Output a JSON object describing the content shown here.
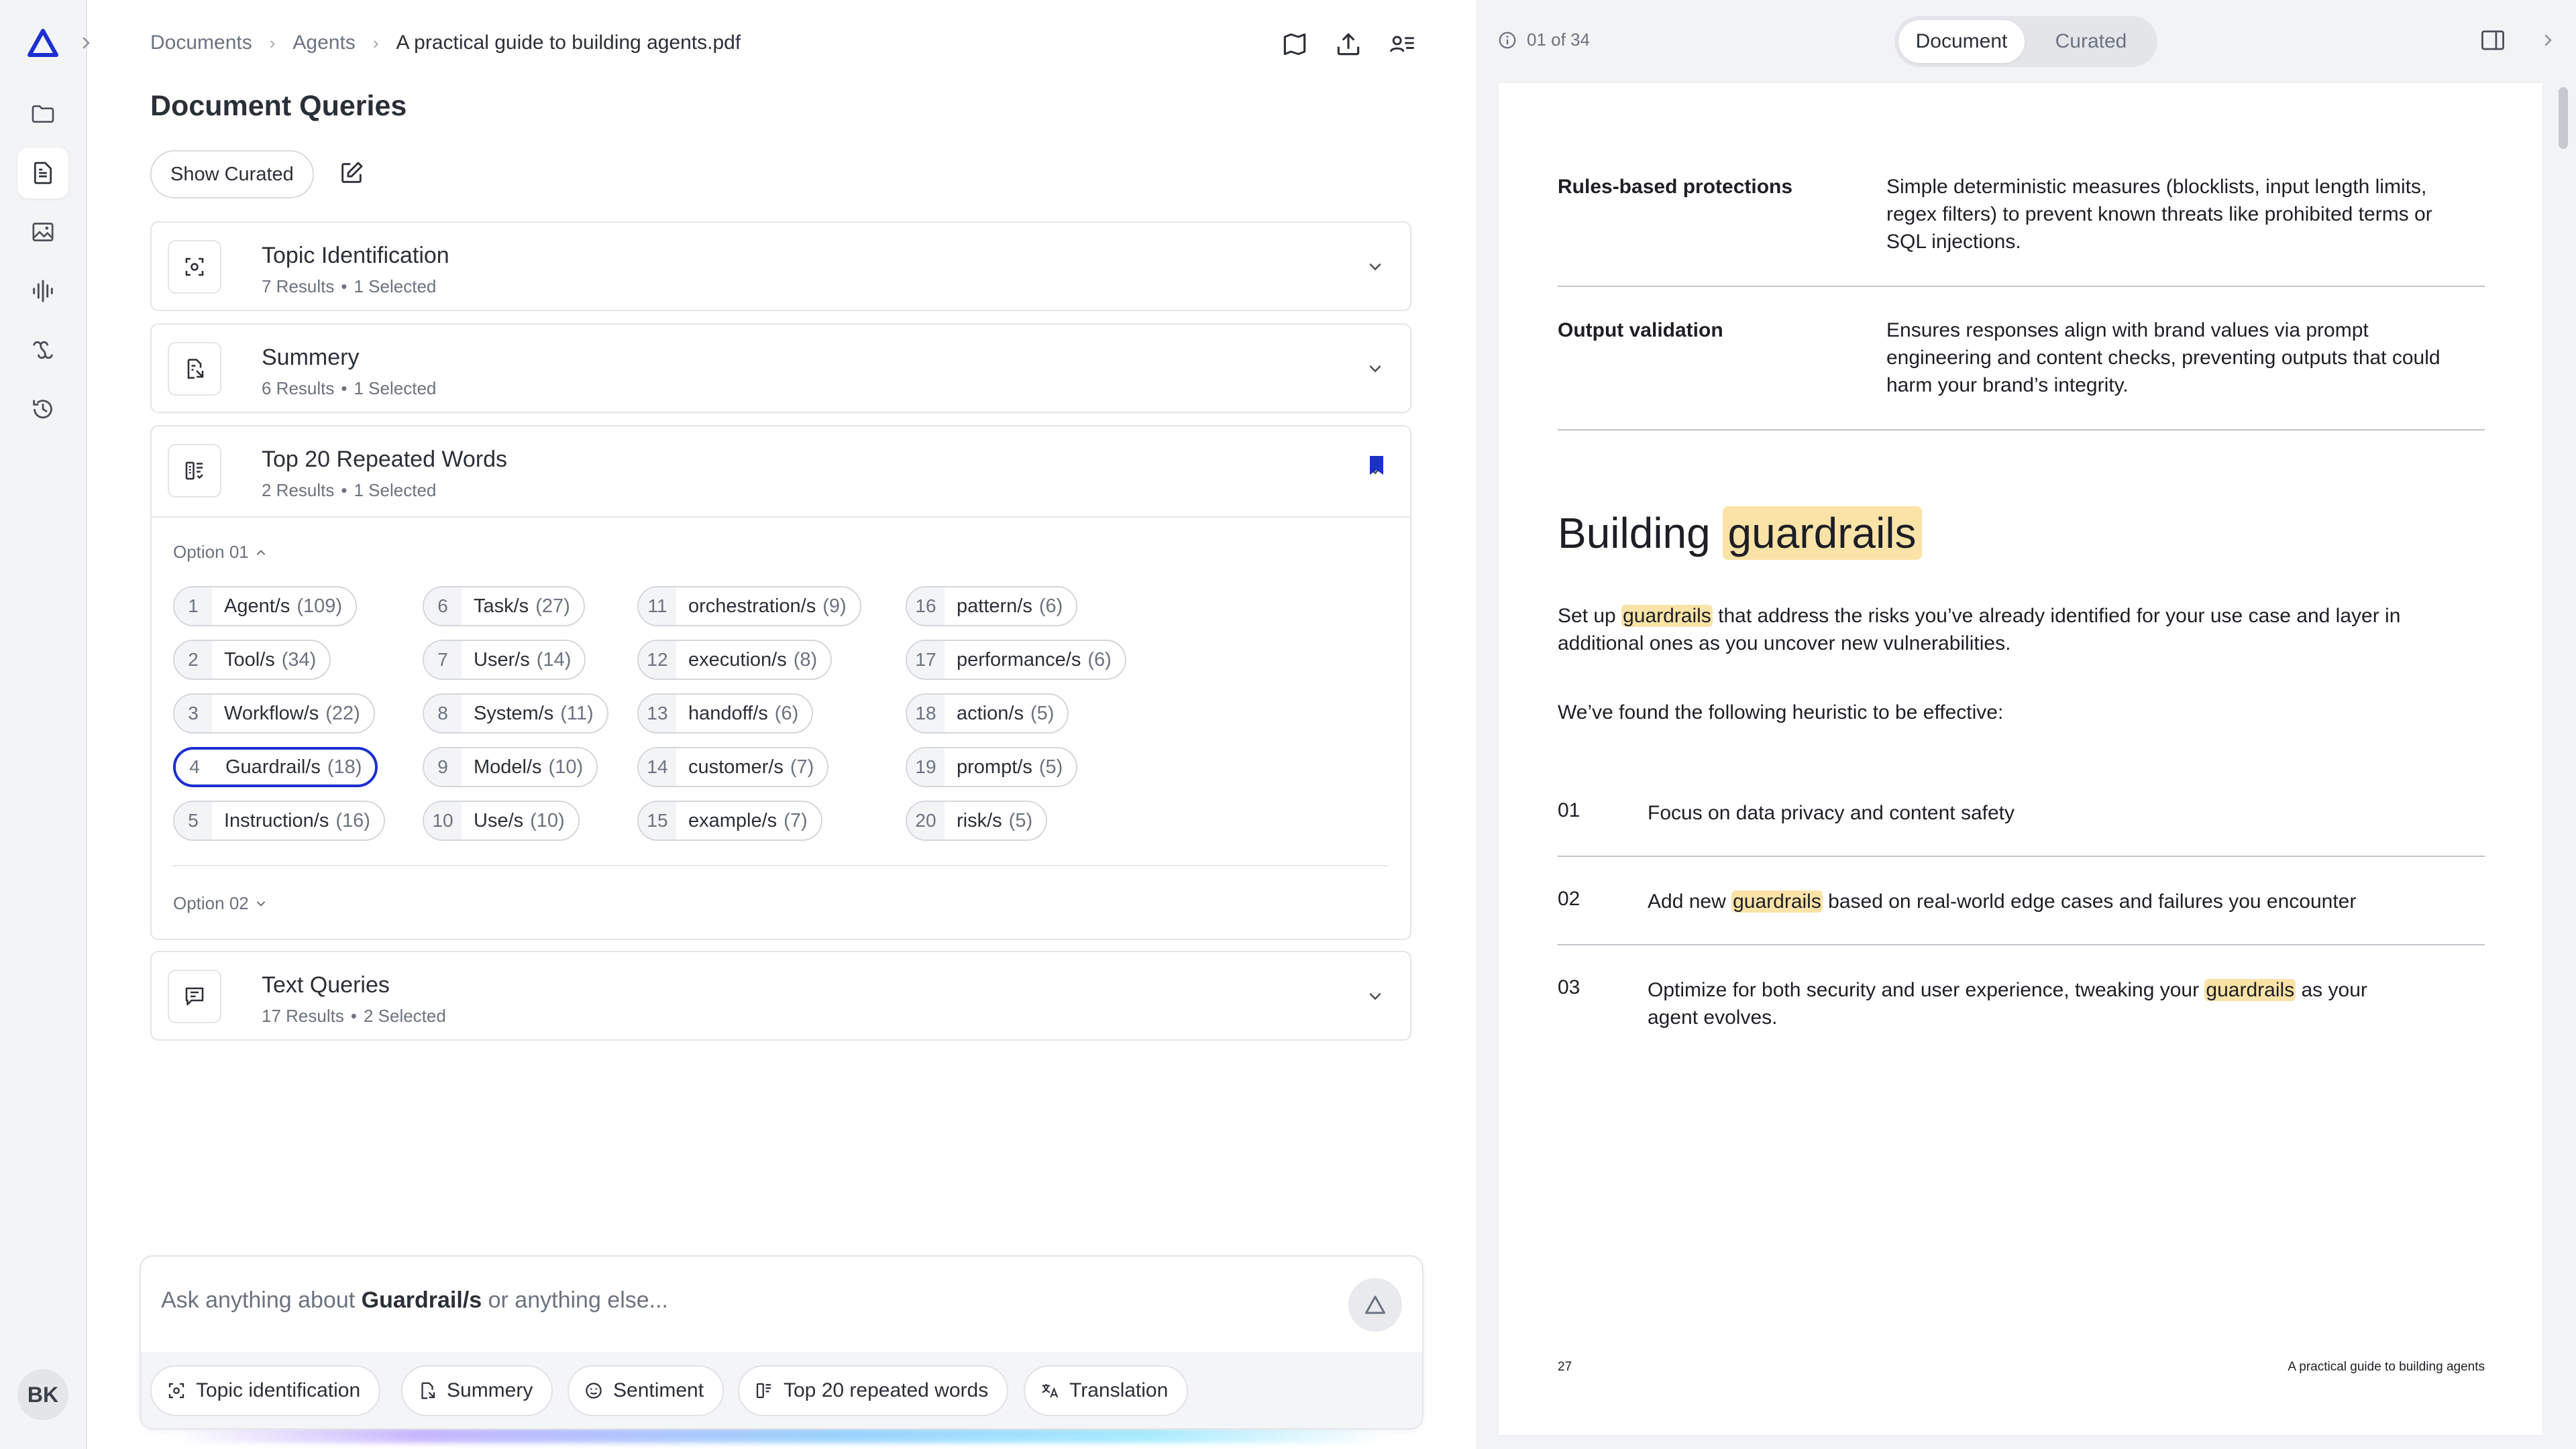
{
  "sidebar": {
    "avatar_initials": "BK",
    "items": [
      {
        "icon": "folder-icon"
      },
      {
        "icon": "document-icon",
        "active": true
      },
      {
        "icon": "image-icon"
      },
      {
        "icon": "audio-waveform-icon"
      },
      {
        "icon": "link-icon"
      },
      {
        "icon": "history-icon"
      }
    ]
  },
  "breadcrumb": {
    "items": [
      "Documents",
      "Agents"
    ],
    "current": "A practical guide to building agents.pdf"
  },
  "header": {
    "title": "Document Queries",
    "show_curated_label": "Show Curated"
  },
  "queries": [
    {
      "title": "Topic Identification",
      "results": "7 Results",
      "selected": "1 Selected"
    },
    {
      "title": "Summery",
      "results": "6 Results",
      "selected": "1 Selected"
    },
    {
      "title": "Top 20 Repeated Words",
      "results": "2 Results",
      "selected": "1 Selected"
    },
    {
      "title": "Text Queries",
      "results": "17 Results",
      "selected": "2 Selected"
    }
  ],
  "options": {
    "option1_label": "Option 01",
    "option2_label": "Option 02"
  },
  "words": [
    {
      "n": "1",
      "word": "Agent/s",
      "count": "(109)"
    },
    {
      "n": "2",
      "word": "Tool/s",
      "count": "(34)"
    },
    {
      "n": "3",
      "word": "Workflow/s",
      "count": "(22)"
    },
    {
      "n": "4",
      "word": "Guardrail/s",
      "count": "(18)",
      "selected": true
    },
    {
      "n": "5",
      "word": "Instruction/s",
      "count": "(16)"
    },
    {
      "n": "6",
      "word": "Task/s",
      "count": "(27)"
    },
    {
      "n": "7",
      "word": "User/s",
      "count": "(14)"
    },
    {
      "n": "8",
      "word": "System/s",
      "count": "(11)"
    },
    {
      "n": "9",
      "word": "Model/s",
      "count": "(10)"
    },
    {
      "n": "10",
      "word": "Use/s",
      "count": "(10)"
    },
    {
      "n": "11",
      "word": "orchestration/s",
      "count": "(9)"
    },
    {
      "n": "12",
      "word": "execution/s",
      "count": "(8)"
    },
    {
      "n": "13",
      "word": "handoff/s",
      "count": "(6)"
    },
    {
      "n": "14",
      "word": "customer/s",
      "count": "(7)"
    },
    {
      "n": "15",
      "word": "example/s",
      "count": "(7)"
    },
    {
      "n": "16",
      "word": "pattern/s",
      "count": "(6)"
    },
    {
      "n": "17",
      "word": "performance/s",
      "count": "(6)"
    },
    {
      "n": "18",
      "word": "action/s",
      "count": "(5)"
    },
    {
      "n": "19",
      "word": "prompt/s",
      "count": "(5)"
    },
    {
      "n": "20",
      "word": "risk/s",
      "count": "(5)"
    }
  ],
  "prompt": {
    "prefix": "Ask anything about",
    "focus": "Guardrail/s",
    "suffix": "or anything else..."
  },
  "quick_actions": [
    {
      "label": "Topic identification",
      "icon": "topic-scan-icon"
    },
    {
      "label": "Summery",
      "icon": "summary-doc-icon"
    },
    {
      "label": "Sentiment",
      "icon": "sentiment-icon"
    },
    {
      "label": "Top 20 repeated words",
      "icon": "repeated-words-icon"
    },
    {
      "label": "Translation",
      "icon": "translate-icon"
    }
  ],
  "viewer": {
    "page_counter": "01 of 34",
    "toggle": [
      "Document",
      "Curated"
    ],
    "active_toggle": "Document"
  },
  "document": {
    "rows": [
      {
        "term": "Rules-based protections",
        "desc": "Simple deterministic measures (blocklists, input length limits, regex filters) to prevent known threats like prohibited terms or SQL injections."
      },
      {
        "term": "Output validation",
        "desc": "Ensures responses align with brand values via prompt engineering and content checks, preventing outputs that could harm your brand’s integrity."
      }
    ],
    "heading_plain": "Building",
    "heading_highlight": "guardrails",
    "para1_a": "Set up",
    "para1_hl": "guardrails",
    "para1_b": "that address the risks you’ve already identified for your use case and layer in additional ones as you uncover new vulnerabilities.",
    "para2": "We’ve found the following heuristic to be effective:",
    "steps": [
      {
        "n": "01",
        "a": "Focus on data privacy and content safety",
        "hl": "",
        "b": ""
      },
      {
        "n": "02",
        "a": "Add new",
        "hl": "guardrails",
        "b": "based on real-world edge cases and failures you encounter"
      },
      {
        "n": "03",
        "a": "Optimize for both security and user experience, tweaking your",
        "hl": "guardrails",
        "b": "as your agent evolves."
      }
    ],
    "footer_page": "27",
    "footer_title": "A practical guide to building agents"
  }
}
